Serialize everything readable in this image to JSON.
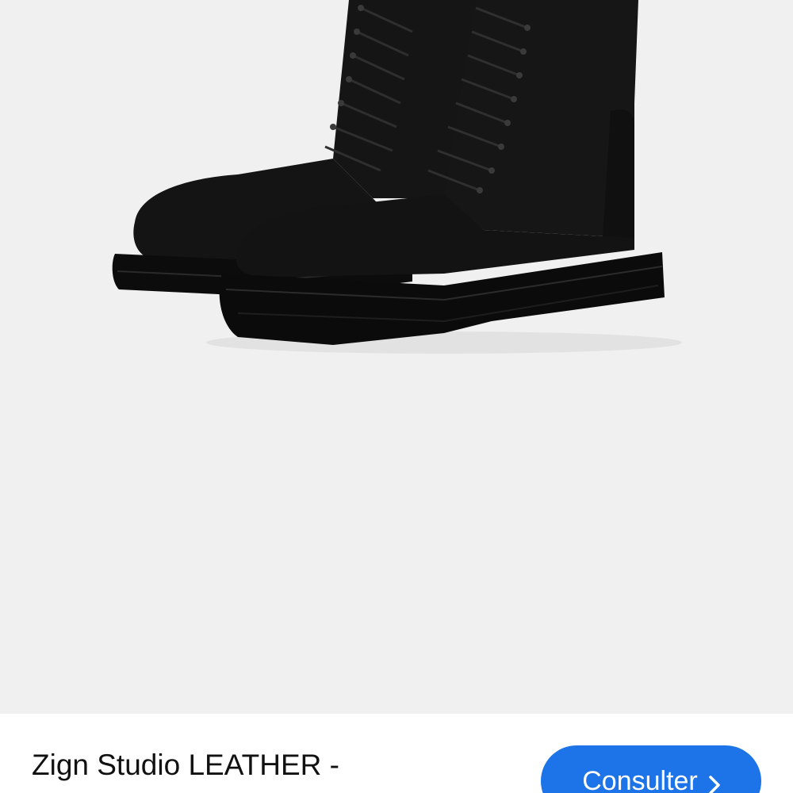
{
  "product": {
    "title": "Zign Studio LEATHER -",
    "image_description_icon": "boot-photo"
  },
  "cta": {
    "label": "Consulter",
    "icon": "chevron-right-icon"
  },
  "colors": {
    "image_background": "#f0f0f0",
    "button": "#1d73e8",
    "button_text": "#ffffff",
    "title_text": "#111111"
  }
}
